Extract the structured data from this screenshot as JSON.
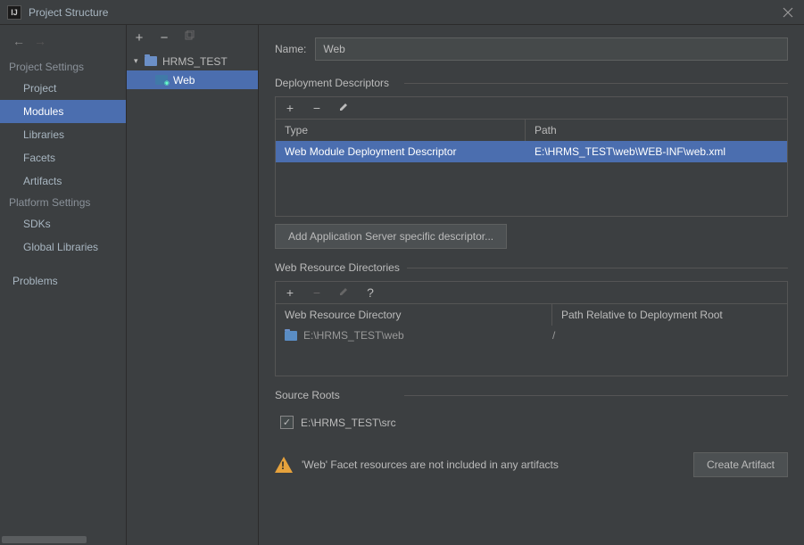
{
  "window": {
    "title": "Project Structure"
  },
  "sidebar": {
    "projectSettingsLabel": "Project Settings",
    "platformSettingsLabel": "Platform Settings",
    "items": {
      "project": "Project",
      "modules": "Modules",
      "libraries": "Libraries",
      "facets": "Facets",
      "artifacts": "Artifacts",
      "sdks": "SDKs",
      "globalLibraries": "Global Libraries",
      "problems": "Problems"
    }
  },
  "tree": {
    "root": "HRMS_TEST",
    "child": "Web"
  },
  "content": {
    "nameLabel": "Name:",
    "nameValue": "Web",
    "deployDesc": {
      "title": "Deployment Descriptors",
      "headers": {
        "type": "Type",
        "path": "Path"
      },
      "row": {
        "type": "Web Module Deployment Descriptor",
        "path": "E:\\HRMS_TEST\\web\\WEB-INF\\web.xml"
      },
      "btn": "Add Application Server specific descriptor..."
    },
    "webRes": {
      "title": "Web Resource Directories",
      "headers": {
        "dir": "Web Resource Directory",
        "rel": "Path Relative to Deployment Root"
      },
      "row": {
        "dir": "E:\\HRMS_TEST\\web",
        "rel": "/"
      }
    },
    "sourceRoots": {
      "title": "Source Roots",
      "item": "E:\\HRMS_TEST\\src"
    },
    "warning": {
      "text": "'Web' Facet resources are not included in any artifacts",
      "btn": "Create Artifact"
    }
  }
}
